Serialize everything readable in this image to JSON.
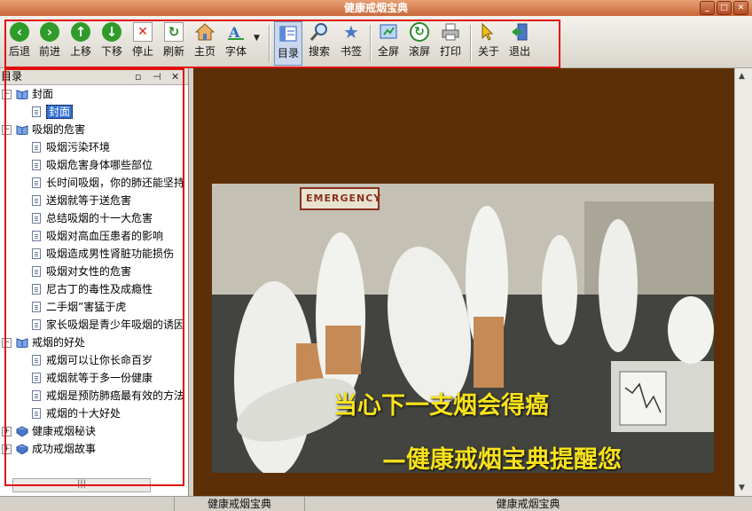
{
  "window": {
    "title": "健康戒烟宝典"
  },
  "toolbar": {
    "buttons": [
      {
        "id": "back",
        "label": "后退",
        "icon": "arrow-left-icon"
      },
      {
        "id": "forward",
        "label": "前进",
        "icon": "arrow-right-icon"
      },
      {
        "id": "up",
        "label": "上移",
        "icon": "arrow-up-icon"
      },
      {
        "id": "down",
        "label": "下移",
        "icon": "arrow-down-icon"
      },
      {
        "id": "stop",
        "label": "停止",
        "icon": "stop-icon"
      },
      {
        "id": "refresh",
        "label": "刷新",
        "icon": "refresh-icon"
      },
      {
        "id": "home",
        "label": "主页",
        "icon": "home-icon"
      },
      {
        "id": "font",
        "label": "字体",
        "icon": "font-icon"
      },
      {
        "id": "toc",
        "label": "目录",
        "icon": "toc-icon"
      },
      {
        "id": "search",
        "label": "搜索",
        "icon": "search-icon"
      },
      {
        "id": "bookmark",
        "label": "书签",
        "icon": "bookmark-star-icon"
      },
      {
        "id": "fullscreen",
        "label": "全屏",
        "icon": "fullscreen-icon"
      },
      {
        "id": "scroll",
        "label": "滚屏",
        "icon": "scroll-icon"
      },
      {
        "id": "print",
        "label": "打印",
        "icon": "printer-icon"
      },
      {
        "id": "about",
        "label": "关于",
        "icon": "about-icon"
      },
      {
        "id": "exit",
        "label": "退出",
        "icon": "exit-icon"
      }
    ]
  },
  "panel": {
    "title": "目录",
    "tree": [
      {
        "label": "封面",
        "level": 0,
        "icon": "book-open-icon"
      },
      {
        "label": "封面",
        "level": 1,
        "selected": true
      },
      {
        "label": "吸烟的危害",
        "level": 0,
        "icon": "book-open-icon"
      },
      {
        "label": "吸烟污染环境",
        "level": 1
      },
      {
        "label": "吸烟危害身体哪些部位",
        "level": 1
      },
      {
        "label": "长时间吸烟，你的肺还能坚持",
        "level": 1
      },
      {
        "label": "送烟就等于送危害",
        "level": 1
      },
      {
        "label": "总结吸烟的十一大危害",
        "level": 1
      },
      {
        "label": "吸烟对高血压患者的影响",
        "level": 1
      },
      {
        "label": "吸烟造成男性肾脏功能损伤",
        "level": 1
      },
      {
        "label": "吸烟对女性的危害",
        "level": 1
      },
      {
        "label": "尼古丁的毒性及成瘾性",
        "level": 1
      },
      {
        "label": "二手烟”害猛于虎",
        "level": 1
      },
      {
        "label": "家长吸烟是青少年吸烟的诱因",
        "level": 1
      },
      {
        "label": "戒烟的好处",
        "level": 0,
        "icon": "book-open-icon"
      },
      {
        "label": "戒烟可以让你长命百岁",
        "level": 1
      },
      {
        "label": "戒烟就等于多一份健康",
        "level": 1
      },
      {
        "label": "戒烟是预防肺癌最有效的方法",
        "level": 1
      },
      {
        "label": "戒烟的十大好处",
        "level": 1
      },
      {
        "label": "健康戒烟秘诀",
        "level": 0,
        "icon": "book-closed-icon"
      },
      {
        "label": "成功戒烟故事",
        "level": 0,
        "icon": "book-closed-icon"
      }
    ]
  },
  "content": {
    "sign_text": "EMERGENCY",
    "caption_line1": "当心下一支烟会得癌",
    "caption_line2": "—健康戒烟宝典提醒您"
  },
  "statusbar": {
    "left": "健康戒烟宝典",
    "right": "健康戒烟宝典"
  },
  "colors": {
    "accent_red": "#e01010",
    "content_bg": "#5c2f06",
    "caption": "#f7e21c",
    "selection": "#2f6fd6"
  }
}
